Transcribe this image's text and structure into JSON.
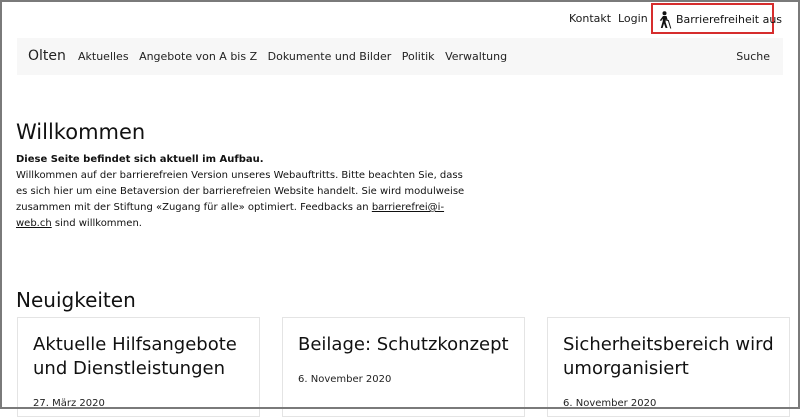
{
  "utility": {
    "contact": "Kontakt",
    "login": "Login",
    "accessibility_toggle": "Barrierefreiheit aus"
  },
  "nav": {
    "brand": "Olten",
    "items": [
      {
        "label": "Aktuelles"
      },
      {
        "label": "Angebote von A bis Z"
      },
      {
        "label": "Dokumente und Bilder"
      },
      {
        "label": "Politik"
      },
      {
        "label": "Verwaltung"
      }
    ],
    "search": "Suche"
  },
  "welcome": {
    "title": "Willkommen",
    "notice": "Diese Seite befindet sich aktuell im Aufbau.",
    "text": "Willkommen auf der barrierefreien Version unseres Webauftritts. Bitte beachten Sie, dass es sich hier um eine Betaversion der barrierefreien Website handelt. Sie wird modulweise zusammen mit der Stiftung «Zugang für alle» optimiert. Feedbacks an",
    "email": "barrierefrei@i-web.ch",
    "text_end": "sind willkommen."
  },
  "news": {
    "title": "Neuigkeiten",
    "cards": [
      {
        "title": "Aktuelle Hilfsangebote und Dienstleistungen",
        "date": "27. März 2020"
      },
      {
        "title": "Beilage: Schutzkonzept",
        "date": "6. November 2020"
      },
      {
        "title": "Sicherheitsbereich wird umorganisiert",
        "date": "6. November 2020"
      }
    ]
  },
  "icons": {
    "accessibility": "pedestrian-with-cane-icon"
  }
}
